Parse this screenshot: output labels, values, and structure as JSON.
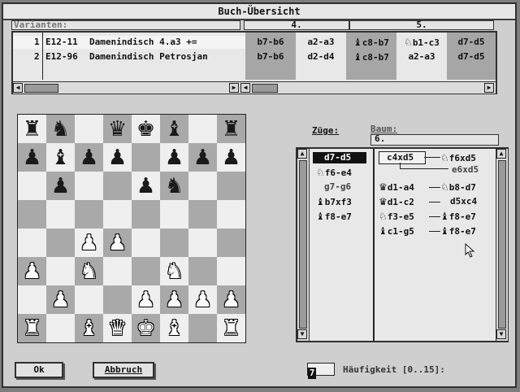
{
  "window": {
    "title": "Buch-Übersicht"
  },
  "variants": {
    "label": "Varianten:",
    "move_col_4": "4.",
    "move_col_5": "5.",
    "rows": [
      {
        "num": "1",
        "code": "E12-11",
        "name": "Damenindisch 4.a3 +=",
        "moves": [
          "b7-b6",
          "a2-a3",
          "c8-b7",
          "b1-c3",
          "d7-d5"
        ]
      },
      {
        "num": "2",
        "code": "E12-96",
        "name": "Damenindisch Petrosjan",
        "moves": [
          "b7-b6",
          "d2-d4",
          "c8-b7",
          "a2-a3",
          "d7-d5"
        ]
      }
    ]
  },
  "board": {
    "rows": [
      [
        "br",
        "bn",
        "",
        "bq",
        "bk",
        "bb",
        "",
        "br"
      ],
      [
        "bp",
        "bb",
        "bp",
        "bp",
        "",
        "bp",
        "bp",
        "bp"
      ],
      [
        "",
        "bp",
        "",
        "",
        "bp",
        "bn",
        "",
        ""
      ],
      [
        "",
        "",
        "",
        "",
        "",
        "",
        "",
        ""
      ],
      [
        "",
        "",
        "wp",
        "wp",
        "",
        "",
        "",
        ""
      ],
      [
        "wp",
        "",
        "wn",
        "",
        "",
        "wn",
        "",
        ""
      ],
      [
        "",
        "wp",
        "",
        "",
        "wp",
        "wp",
        "wp",
        "wp"
      ],
      [
        "wr",
        "",
        "wb",
        "wq",
        "wk",
        "wb",
        "",
        "wr"
      ]
    ]
  },
  "moves_panel": {
    "zuege_label": "Züge:",
    "baum_label": "Baum:",
    "baum_value": "6.",
    "list": [
      {
        "icon": "",
        "text": "d7-d5",
        "selected": true
      },
      {
        "icon": "knight",
        "text": "f6-e4",
        "selected": false
      },
      {
        "icon": "",
        "text": "g7-g6",
        "selected": false
      },
      {
        "icon": "bishop",
        "text": "b7xf3",
        "selected": false
      },
      {
        "icon": "bishop",
        "text": "f8-e7",
        "selected": false
      }
    ],
    "tree": {
      "r1a": "c4xd5",
      "r1b": "f6xd5",
      "r2": "e6xd5",
      "r3a": "d1-a4",
      "r3b": "b8-d7",
      "r4a": "d1-c2",
      "r4b": "d5xc4",
      "r5a": "f3-e5",
      "r5b": "f8-e7",
      "r6a": "c1-g5",
      "r6b": "f8-e7"
    }
  },
  "footer": {
    "ok": "Ok",
    "cancel": "Abbruch",
    "freq_value": "7",
    "freq_label": "Häufigkeit [0..15]:"
  }
}
